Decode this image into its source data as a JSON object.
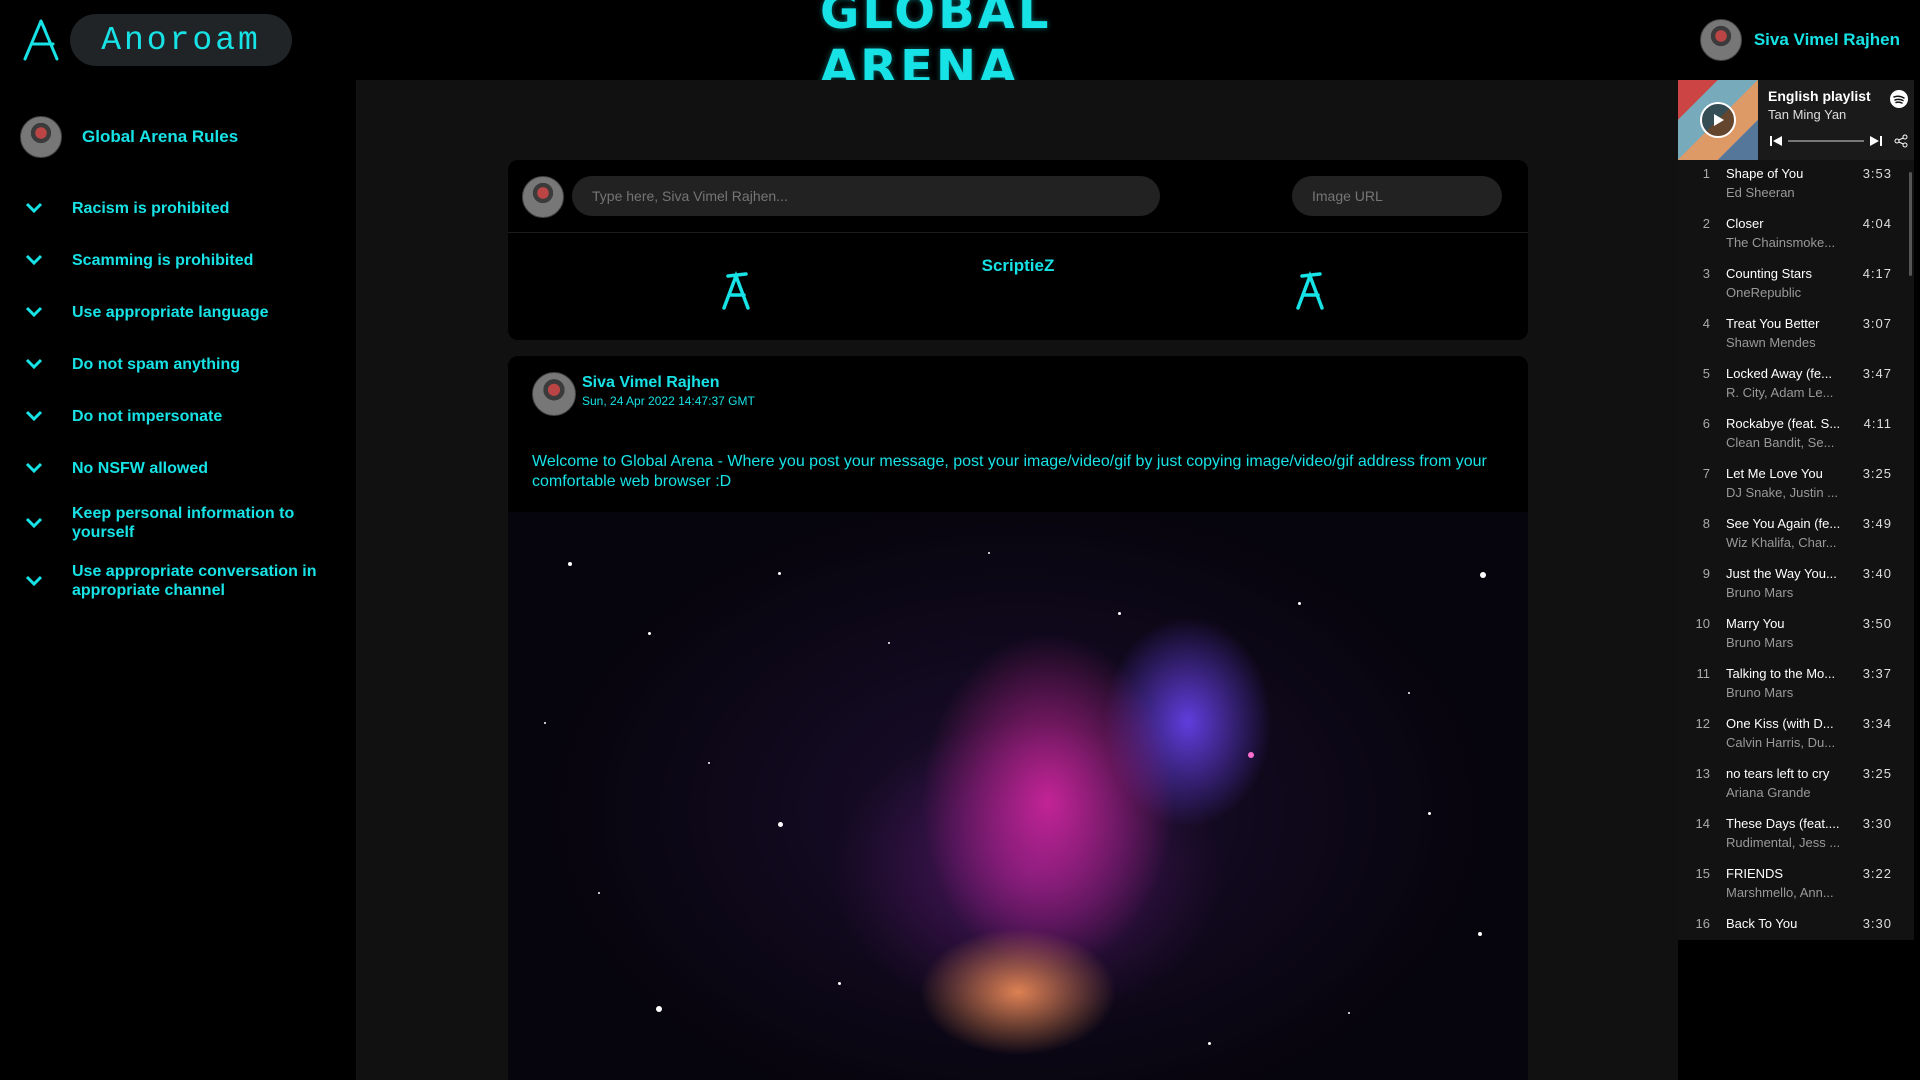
{
  "header": {
    "brand": "Anoroam",
    "site_title": "GLOBAL ARENA",
    "user_name": "Siva Vimel Rajhen"
  },
  "sidebar": {
    "title": "Global Arena Rules",
    "rules": [
      "Racism is prohibited",
      "Scamming is prohibited",
      "Use appropriate language",
      "Do not spam anything",
      "Do not impersonate",
      "No NSFW allowed",
      "Keep personal information to yourself",
      "Use appropriate conversation in appropriate channel"
    ]
  },
  "compose": {
    "message_placeholder": "Type here, Siva Vimel Rajhen...",
    "image_placeholder": "Image URL",
    "author": "ScriptieZ"
  },
  "post": {
    "author": "Siva Vimel Rajhen",
    "date": "Sun, 24 Apr 2022 14:47:37 GMT",
    "text": "Welcome to Global Arena - Where you post your message, post your image/video/gif by just copying image/video/gif address from your comfortable web browser :D"
  },
  "playlist": {
    "title": "English playlist",
    "owner": "Tan Ming Yan",
    "tracks": [
      {
        "num": "1",
        "name": "Shape of You",
        "artist": "Ed Sheeran",
        "duration": "3:53"
      },
      {
        "num": "2",
        "name": "Closer",
        "artist": "The Chainsmoke...",
        "duration": "4:04"
      },
      {
        "num": "3",
        "name": "Counting Stars",
        "artist": "OneRepublic",
        "duration": "4:17"
      },
      {
        "num": "4",
        "name": "Treat You Better",
        "artist": "Shawn Mendes",
        "duration": "3:07"
      },
      {
        "num": "5",
        "name": "Locked Away (fe...",
        "artist": "R. City, Adam Le...",
        "duration": "3:47"
      },
      {
        "num": "6",
        "name": "Rockabye (feat. S...",
        "artist": "Clean Bandit, Se...",
        "duration": "4:11"
      },
      {
        "num": "7",
        "name": "Let Me Love You",
        "artist": "DJ Snake, Justin ...",
        "duration": "3:25"
      },
      {
        "num": "8",
        "name": "See You Again (fe...",
        "artist": "Wiz Khalifa, Char...",
        "duration": "3:49"
      },
      {
        "num": "9",
        "name": "Just the Way You...",
        "artist": "Bruno Mars",
        "duration": "3:40"
      },
      {
        "num": "10",
        "name": "Marry You",
        "artist": "Bruno Mars",
        "duration": "3:50"
      },
      {
        "num": "11",
        "name": "Talking to the Mo...",
        "artist": "Bruno Mars",
        "duration": "3:37"
      },
      {
        "num": "12",
        "name": "One Kiss (with D...",
        "artist": "Calvin Harris, Du...",
        "duration": "3:34"
      },
      {
        "num": "13",
        "name": "no tears left to cry",
        "artist": "Ariana Grande",
        "duration": "3:25"
      },
      {
        "num": "14",
        "name": "These Days (feat....",
        "artist": "Rudimental, Jess ...",
        "duration": "3:30"
      },
      {
        "num": "15",
        "name": "FRIENDS",
        "artist": "Marshmello, Ann...",
        "duration": "3:22"
      },
      {
        "num": "16",
        "name": "Back To You",
        "artist": "",
        "duration": "3:30"
      }
    ]
  },
  "colors": {
    "accent": "#17e2e6",
    "background": "#000000",
    "main_panel": "#111111"
  }
}
